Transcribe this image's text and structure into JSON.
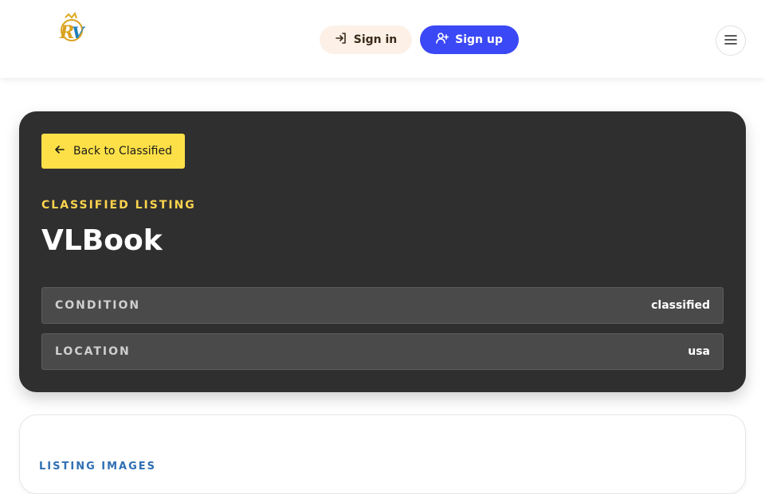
{
  "header": {
    "logo_icon": "rv-logo-icon",
    "sign_in_label": "Sign in",
    "sign_in_icon": "login-arrow-icon",
    "sign_up_label": "Sign up",
    "sign_up_icon": "user-plus-icon",
    "menu_icon": "hamburger-menu-icon",
    "sign_up_color": "#3b48f5",
    "sign_in_color": "#fdf1e7"
  },
  "listing": {
    "back_label": "Back to Classified",
    "back_icon": "arrow-left-icon",
    "eyebrow": "CLASSIFIED LISTING",
    "title": "VLBook",
    "details": [
      {
        "label": "CONDITION",
        "value": "classified"
      },
      {
        "label": "LOCATION",
        "value": "usa"
      }
    ],
    "accent_color": "#fde047",
    "card_color": "#2f2f30"
  },
  "images_section": {
    "label": "LISTING IMAGES"
  }
}
